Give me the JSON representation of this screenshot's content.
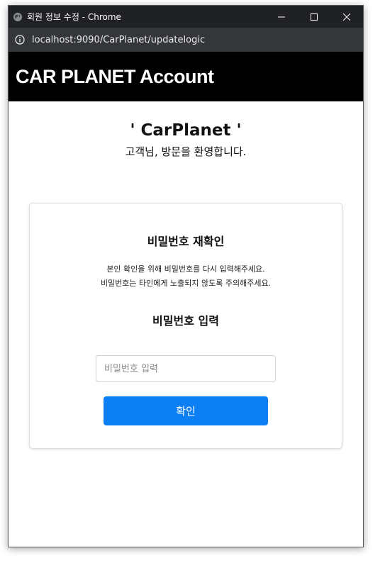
{
  "window": {
    "title": "회원 정보 수정 - Chrome",
    "url": "localhost:9090/CarPlanet/updatelogic",
    "controls": [
      "minimize",
      "maximize",
      "close"
    ]
  },
  "header": {
    "brand": "CAR PLANET Account",
    "background": "#000000"
  },
  "hero": {
    "logo_text": "' CarPlanet '",
    "welcome": "고객님, 방문을 환영합니다."
  },
  "card": {
    "title": "비밀번호 재확인",
    "desc_line1": "본인 확인을 위해 비밀번호를 다시 입력해주세요.",
    "desc_line2": "비밀번호는 타인에게 노출되지 않도록 주의해주세요.",
    "input_title": "비밀번호 입력",
    "password_placeholder": "비밀번호 입력",
    "password_value": "",
    "confirm_label": "확인",
    "confirm_color": "#0d7ff5"
  }
}
